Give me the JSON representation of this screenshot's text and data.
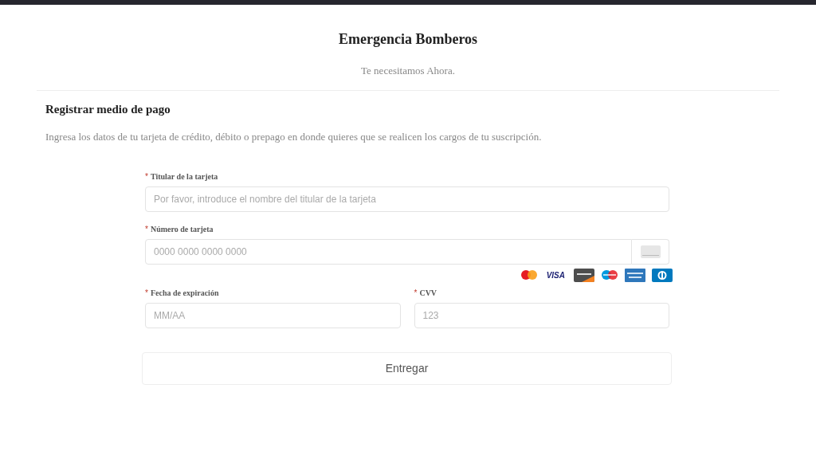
{
  "header": {
    "title": "Emergencia Bomberos",
    "subtitle": "Te necesitamos Ahora."
  },
  "section": {
    "title": "Registrar medio de pago",
    "description": "Ingresa los datos de tu tarjeta de crédito, débito o prepago en donde quieres que se realicen los cargos de tu suscripción."
  },
  "fields": [
    {
      "marker": "*",
      "label": "Titular de la tarjeta",
      "placeholder": "Por favor, introduce el nombre del titular de la tarjeta",
      "kind": "full"
    },
    {
      "marker": "*",
      "label": "Número de tarjeta",
      "placeholder": "0000 0000 0000 0000",
      "kind": "card"
    },
    {
      "marker": "*",
      "label": "Fecha de expiración",
      "placeholder": "MM/AA",
      "kind": "half"
    },
    {
      "marker": "*",
      "label": "CVV",
      "placeholder": "123",
      "kind": "half"
    }
  ],
  "card_brands": [
    {
      "kind": "mastercard"
    },
    {
      "kind": "visa",
      "label": "VISA"
    },
    {
      "kind": "discover"
    },
    {
      "kind": "maestro"
    },
    {
      "kind": "amex"
    },
    {
      "kind": "diners"
    }
  ],
  "submit_button": "Entregar"
}
